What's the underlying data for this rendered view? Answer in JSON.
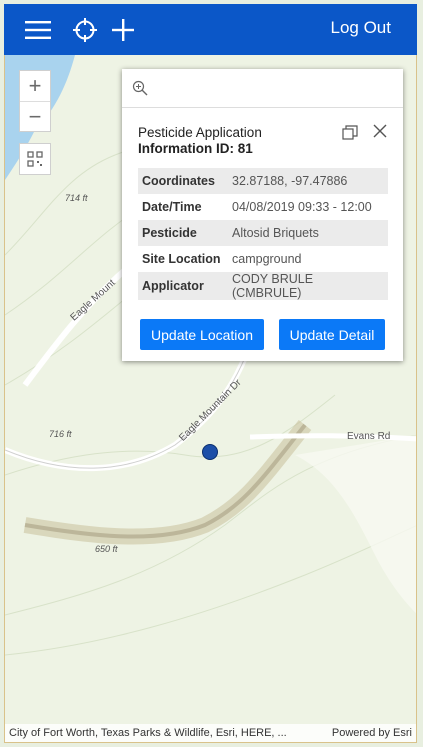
{
  "topbar": {
    "logout_label": "Log Out",
    "color": "#0b57c8"
  },
  "map": {
    "labels": {
      "elev1": "714 ft",
      "elev2": "716 ft",
      "elev3": "650 ft"
    },
    "roads": {
      "road1": "Eagle Mount",
      "road2": "Eagle Mountain Dr",
      "road3": "Evans Rd"
    },
    "attribution": "City of Fort Worth, Texas Parks & Wildlife, Esri, HERE, ...",
    "powered_by": "Powered by Esri"
  },
  "popup": {
    "title_line1": "Pesticide Application",
    "title_line2": "Information ID: 81",
    "rows": [
      {
        "key": "Coordinates",
        "value": "32.87188, -97.47886"
      },
      {
        "key": "Date/Time",
        "value": "04/08/2019 09:33 - 12:00"
      },
      {
        "key": "Pesticide",
        "value": "Altosid Briquets"
      },
      {
        "key": "Site Location",
        "value": "campground"
      },
      {
        "key": "Applicator",
        "value": "CODY BRULE (CMBRULE)"
      }
    ],
    "update_location_label": "Update Location",
    "update_detail_label": "Update Detail",
    "button_color": "#0b79f7"
  }
}
